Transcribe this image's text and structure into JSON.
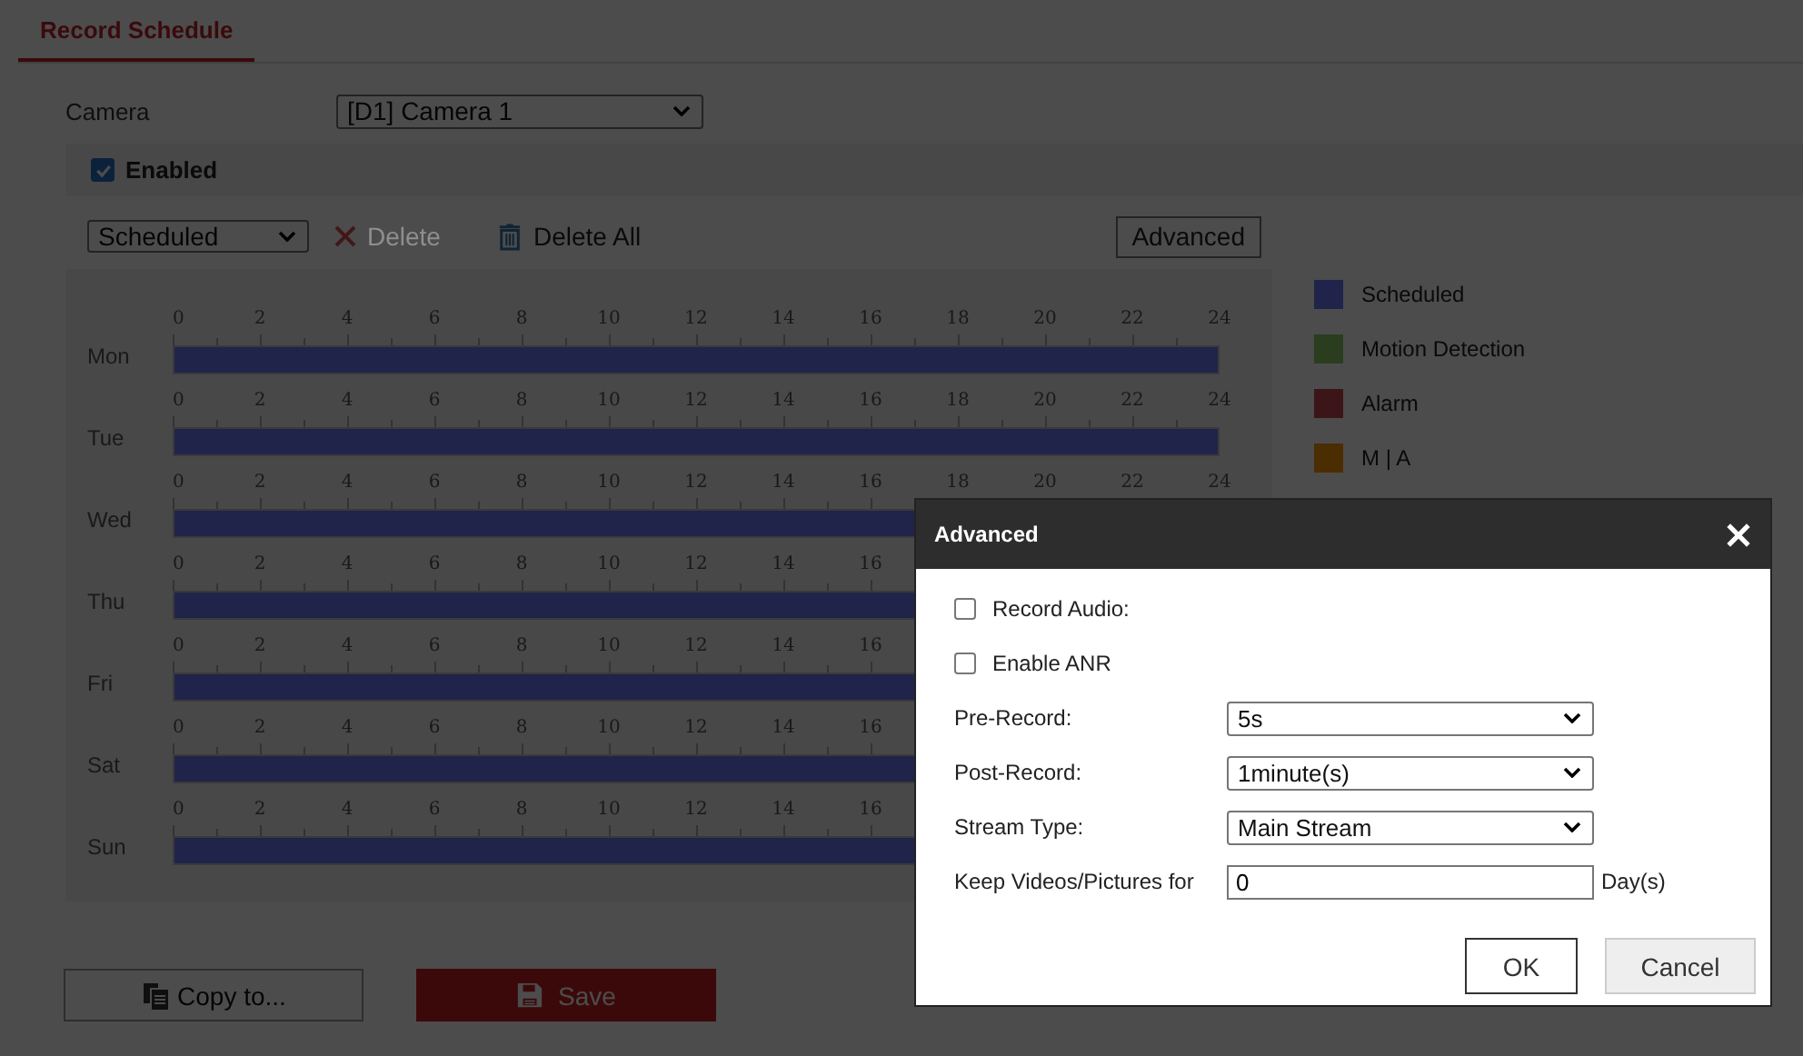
{
  "tab": {
    "label": "Record Schedule",
    "selected": true
  },
  "camera": {
    "label": "Camera",
    "value": "[D1] Camera 1"
  },
  "enabled": {
    "label": "Enabled",
    "checked": true
  },
  "toolbar": {
    "type_value": "Scheduled",
    "delete": {
      "label": "Delete",
      "disabled": true
    },
    "delete_all": {
      "label": "Delete All",
      "disabled": false
    },
    "advanced": "Advanced"
  },
  "schedule": [
    {
      "day": "Mon",
      "color": "#20244a",
      "ticks": [
        "0",
        "2",
        "4",
        "6",
        "8",
        "10",
        "12",
        "14",
        "16",
        "18",
        "20",
        "22",
        "24"
      ]
    },
    {
      "day": "Tue",
      "color": "#20244a",
      "ticks": [
        "0",
        "2",
        "4",
        "6",
        "8",
        "10",
        "12",
        "14",
        "16",
        "18",
        "20",
        "22",
        "24"
      ]
    },
    {
      "day": "Wed",
      "color": "#20244a",
      "ticks": [
        "0",
        "2",
        "4",
        "6",
        "8",
        "10",
        "12",
        "14",
        "16",
        "18",
        "20",
        "22",
        "24"
      ]
    },
    {
      "day": "Thu",
      "color": "#20244a",
      "ticks": [
        "0",
        "2",
        "4",
        "6",
        "8",
        "10",
        "12",
        "14",
        "16"
      ]
    },
    {
      "day": "Fri",
      "color": "#20244a",
      "ticks": [
        "0",
        "2",
        "4",
        "6",
        "8",
        "10",
        "12",
        "14",
        "16"
      ]
    },
    {
      "day": "Sat",
      "color": "#20244a",
      "ticks": [
        "0",
        "2",
        "4",
        "6",
        "8",
        "10",
        "12",
        "14",
        "16"
      ]
    },
    {
      "day": "Sun",
      "color": "#20244a",
      "ticks": [
        "0",
        "2",
        "4",
        "6",
        "8",
        "10",
        "12",
        "14",
        "16"
      ]
    }
  ],
  "legend": [
    {
      "label": "Scheduled",
      "color": "#20244a"
    },
    {
      "label": "Motion Detection",
      "color": "#2a3d1f"
    },
    {
      "label": "Alarm",
      "color": "#3c1519"
    },
    {
      "label": "M | A",
      "color": "#4a2d00"
    }
  ],
  "buttons": {
    "copy": "Copy to...",
    "save": "Save"
  },
  "dialog": {
    "title": "Advanced",
    "checkboxes": [
      {
        "label": "Record Audio:",
        "checked": false
      },
      {
        "label": "Enable ANR",
        "checked": false
      }
    ],
    "fields": [
      {
        "label": "Pre-Record:",
        "kind": "select",
        "value": "5s"
      },
      {
        "label": "Post-Record:",
        "kind": "select",
        "value": "1minute(s)"
      },
      {
        "label": "Stream Type:",
        "kind": "select",
        "value": "Main Stream"
      },
      {
        "label": "Keep Videos/Pictures for",
        "kind": "input",
        "value": "0",
        "unit": "Day(s)"
      }
    ],
    "buttons": [
      {
        "label": "OK",
        "kind": "primary"
      },
      {
        "label": "Cancel",
        "kind": "secondary"
      }
    ]
  }
}
